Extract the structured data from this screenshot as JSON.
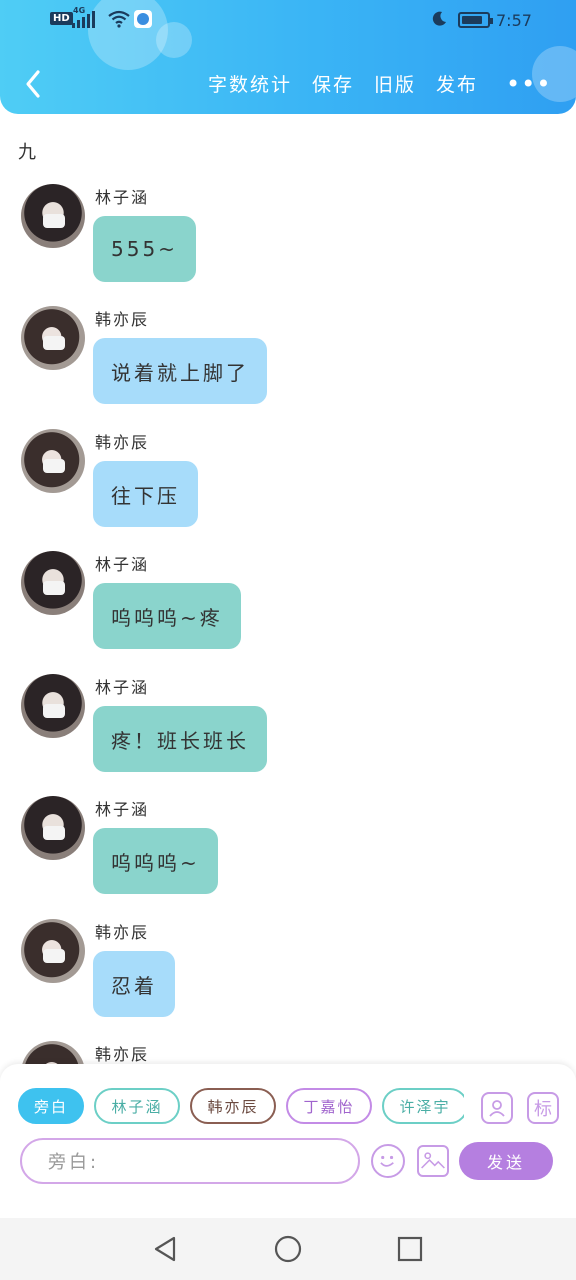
{
  "status_bar": {
    "hd": "HD",
    "network": "4G",
    "time": "7:57",
    "battery_level": 0.85
  },
  "toolbar": {
    "items": [
      "字数统计",
      "保存",
      "旧版",
      "发布"
    ],
    "more": "•••"
  },
  "chapter": "九",
  "messages": [
    {
      "name": "林子涵",
      "text": "555~",
      "style": "green",
      "avatar": "a"
    },
    {
      "name": "韩亦辰",
      "text": "说着就上脚了",
      "style": "blue",
      "avatar": "b"
    },
    {
      "name": "韩亦辰",
      "text": "往下压",
      "style": "blue",
      "avatar": "b"
    },
    {
      "name": "林子涵",
      "text": "呜呜呜~疼",
      "style": "green",
      "avatar": "a"
    },
    {
      "name": "林子涵",
      "text": "疼！班长班长",
      "style": "green",
      "avatar": "a"
    },
    {
      "name": "林子涵",
      "text": "呜呜呜~",
      "style": "green",
      "avatar": "a"
    },
    {
      "name": "韩亦辰",
      "text": "忍着",
      "style": "blue",
      "avatar": "b"
    },
    {
      "name": "韩亦辰",
      "text": "",
      "style": "blue",
      "avatar": "b"
    }
  ],
  "composer": {
    "chips": [
      "旁白",
      "林子涵",
      "韩亦辰",
      "丁嘉怡",
      "许泽宇"
    ],
    "tag_label": "标",
    "placeholder": "旁白:",
    "send_label": "发送"
  },
  "colors": {
    "header": "#3ab4f5",
    "green_bubble": "#8ad4cc",
    "blue_bubble": "#a7dcfa",
    "send": "#b57fe0"
  }
}
